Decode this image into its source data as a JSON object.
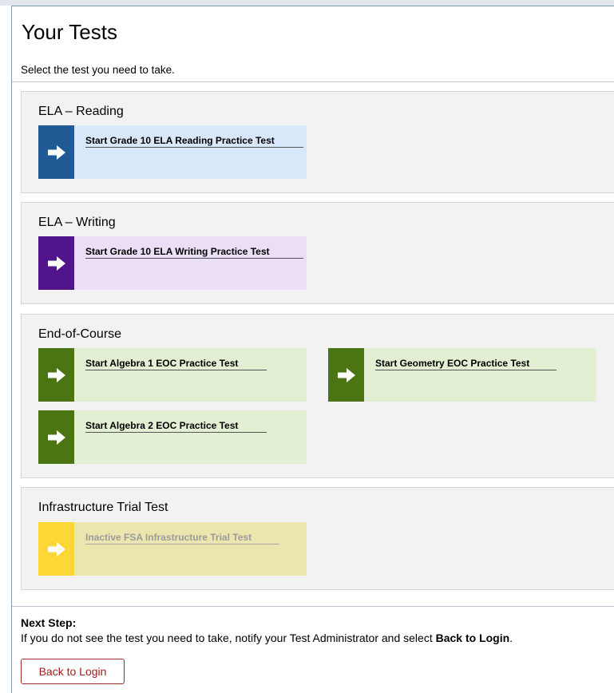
{
  "page": {
    "title": "Your Tests",
    "subtitle": "Select the test you need to take."
  },
  "groups": {
    "reading": {
      "title": "ELA – Reading",
      "tests": [
        "Start Grade 10 ELA Reading Practice Test"
      ]
    },
    "writing": {
      "title": "ELA – Writing",
      "tests": [
        "Start Grade 10 ELA Writing Practice Test"
      ]
    },
    "eoc": {
      "title": "End-of-Course",
      "tests": [
        "Start Algebra 1 EOC Practice Test",
        "Start Geometry EOC Practice Test",
        "Start Algebra 2 EOC Practice Test"
      ]
    },
    "infra": {
      "title": "Infrastructure Trial Test",
      "tests": [
        "Inactive FSA Infrastructure Trial Test"
      ]
    }
  },
  "next_step": {
    "heading": "Next Step:",
    "text_before": "If you do not see the test you need to take, notify your Test Administrator and select ",
    "text_bold": "Back to Login",
    "text_after": "."
  },
  "buttons": {
    "back_to_login": "Back to Login"
  },
  "colors": {
    "reading": "#1f5a95",
    "writing": "#51148a",
    "eoc": "#4b7413",
    "infra": "#fdd735",
    "back_button": "#a31b1b"
  },
  "icons": {
    "tile_arrow": "arrow-right-icon"
  }
}
